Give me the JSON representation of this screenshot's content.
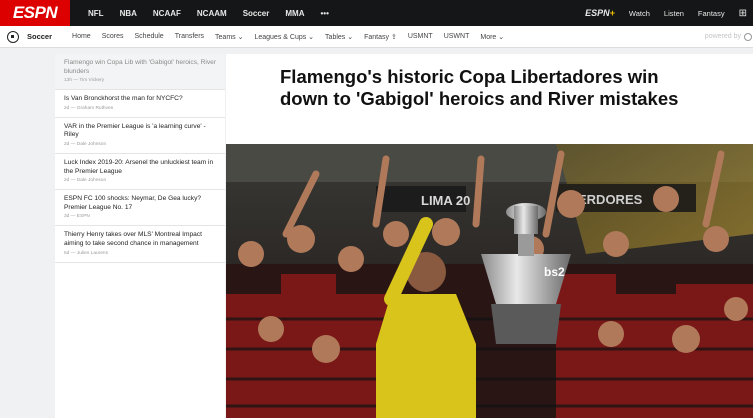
{
  "header": {
    "logo": "ESPN",
    "nav": [
      "NFL",
      "NBA",
      "NCAAF",
      "NCAAM",
      "Soccer",
      "MMA",
      "•••"
    ],
    "plus_brand": "ESPN",
    "plus_mark": "+",
    "right_links": [
      "Watch",
      "Listen",
      "Fantasy"
    ],
    "grid_icon": "apps-grid-icon"
  },
  "subheader": {
    "section": "Soccer",
    "links": [
      "Home",
      "Scores",
      "Schedule",
      "Transfers",
      "Teams ⌄",
      "Leagues & Cups ⌄",
      "Tables ⌄",
      "Fantasy ⇪",
      "USMNT",
      "USWNT",
      "More ⌄"
    ],
    "powered_by": "powered by"
  },
  "sidebar": {
    "stories": [
      {
        "headline": "Flamengo win Copa Lib with 'Gabigol' heroics, River blunders",
        "meta": "13h — Tim Vickery",
        "active": true
      },
      {
        "headline": "Is Van Bronckhorst the man for NYCFC?",
        "meta": "2d — Graham Ruthven"
      },
      {
        "headline": "VAR in the Premier League is 'a learning curve' - Riley",
        "meta": "2d — Dale Johnson"
      },
      {
        "headline": "Luck Index 2019-20: Arsenel the unluckiest team in the Premier League",
        "meta": "2d — Dale Johnson"
      },
      {
        "headline": "ESPN FC 100 shocks: Neymar, De Gea lucky? Premier League No. 17",
        "meta": "3d — ESPN"
      },
      {
        "headline": "Thierry Henry takes over MLS' Montreal Impact aiming to take second chance in management",
        "meta": "5d — Julien Laurens"
      }
    ]
  },
  "article": {
    "headline": "Flamengo's historic Copa Libertadores win down to 'Gabigol' heroics and River mistakes",
    "photo_banner_left": "LIMA 20",
    "photo_banner_right": "ERDORES",
    "shirt_sponsor": "bs2"
  }
}
